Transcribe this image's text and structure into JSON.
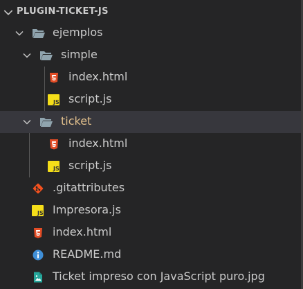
{
  "explorer": {
    "section_title": "PLUGIN-TICKET-JS",
    "tree": [
      {
        "label": "ejemplos",
        "kind": "folder",
        "expanded": true
      },
      {
        "label": "simple",
        "kind": "folder",
        "expanded": true
      },
      {
        "label": "index.html",
        "kind": "html-file"
      },
      {
        "label": "script.js",
        "kind": "js-file"
      },
      {
        "label": "ticket",
        "kind": "folder",
        "expanded": true,
        "selected": true
      },
      {
        "label": "index.html",
        "kind": "html-file"
      },
      {
        "label": "script.js",
        "kind": "js-file"
      },
      {
        "label": ".gitattributes",
        "kind": "git-file"
      },
      {
        "label": "Impresora.js",
        "kind": "js-file"
      },
      {
        "label": "index.html",
        "kind": "html-file"
      },
      {
        "label": "README.md",
        "kind": "info-file"
      },
      {
        "label": "Ticket impreso con JavaScript puro.jpg",
        "kind": "image-file"
      }
    ]
  },
  "colors": {
    "background": "#252526",
    "selected_row": "#37373d",
    "text": "#cccccc",
    "active_folder_text": "#e2c08d",
    "folder_icon": "#90a4ae",
    "html_icon": "#e44d26",
    "js_icon": "#f5de19",
    "git_icon": "#f4511e",
    "info_icon": "#3f8fd8",
    "image_icon": "#26a69a",
    "indent_guide": "#585858"
  }
}
